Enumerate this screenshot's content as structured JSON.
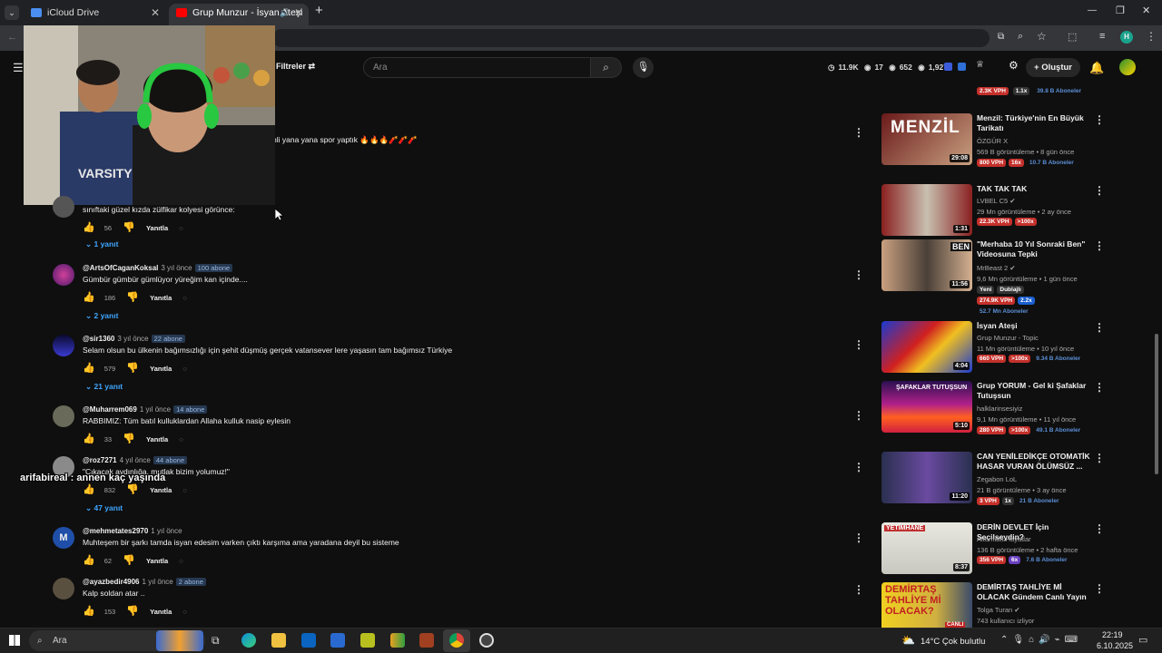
{
  "browser": {
    "tabs": [
      {
        "label": "iCloud Drive",
        "active": false
      },
      {
        "label": "Grup Munzur - İsyan Ateşi",
        "active": true
      }
    ],
    "new_tab": "+",
    "window_min": "—",
    "window_restore": "❐",
    "window_close": "✕"
  },
  "youtube": {
    "filters_label": "Filtreler",
    "search_placeholder": "Ara",
    "stats": {
      "a": "11.9K",
      "b": "17",
      "c": "652",
      "d": "1,927"
    },
    "create_label": "Oluştur"
  },
  "partial_text": {
    "top_comment_tail": "nli yana yana spor yaptık 🔥🔥🔥🧨🧨🧨",
    "top_right_tags": [
      "2.3K VPH",
      "1.1x",
      "39.8 B Aboneler"
    ]
  },
  "comments": [
    {
      "handle": "",
      "date": "",
      "subs": "",
      "text": "sınıftaki güzel kızda zülfikar kolyesi görünce:",
      "likes": "56",
      "reply": "Yanıtla",
      "replies": "1 yanıt"
    },
    {
      "handle": "@ArtsOfCaganKoksal",
      "date": "3 yıl önce",
      "subs": "100 abone",
      "text": "Gümbür gümbür gümlüyor yüreğim kan içinde....",
      "likes": "186",
      "reply": "Yanıtla",
      "replies": "2 yanıt"
    },
    {
      "handle": "@sir1360",
      "date": "3 yıl önce",
      "subs": "22 abone",
      "text": "Selam olsun bu ülkenin bağımsızlığı için şehit düşmüş gerçek  vatansever lere yaşasın tam bağımsız Türkiye",
      "likes": "579",
      "reply": "Yanıtla",
      "replies": "21 yanıt"
    },
    {
      "handle": "@Muharrem069",
      "date": "1 yıl önce",
      "subs": "14 abone",
      "text": "RABBIMIZ: Tüm batıl kulluklardan Allaha kulluk nasip eylesin",
      "likes": "33",
      "reply": "Yanıtla",
      "replies": ""
    },
    {
      "handle": "@roz7271",
      "date": "4 yıl önce",
      "subs": "44 abone",
      "text": "\"Çıkacak aydınlığa, mutlak bizim yolumuz!\"",
      "likes": "832",
      "reply": "Yanıtla",
      "replies": "47 yanıt"
    },
    {
      "handle": "@mehmetates2970",
      "date": "1 yıl önce",
      "subs": "",
      "text": "Muhteşem bir şarkı tamda isyan edesim varken çıktı karşıma ama yaradana deyil bu sisteme",
      "likes": "62",
      "reply": "Yanıtla",
      "replies": "",
      "avatar_letter": "M"
    },
    {
      "handle": "@ayazbedir4906",
      "date": "1 yıl önce",
      "subs": "2 abone",
      "text": "Kalp soldan atar ..",
      "likes": "153",
      "reply": "Yanıtla",
      "replies": ""
    }
  ],
  "overlay_text": "arifabireal : annen kaç yaşında",
  "recommendations": [
    {
      "title": "Menzil: Türkiye'nin En Büyük Tarikatı",
      "channel": "ÖZGÜR X",
      "meta": "569 B görüntüleme • 8 gün önce",
      "duration": "29:08",
      "tags": [
        "800 VPH",
        "16x",
        "10.7 B Aboneler"
      ]
    },
    {
      "title": "TAK TAK TAK",
      "channel": "LVBEL C5 ✔",
      "meta": "29 Mn görüntüleme • 2 ay önce",
      "duration": "1:31",
      "tags": [
        "22.3K VPH",
        ">100x"
      ]
    },
    {
      "title": "\"Merhaba 10 Yıl Sonraki Ben\" Videosuna Tepki",
      "channel": "MrBeast 2 ✔",
      "meta": "9,6 Mn görüntüleme • 1 gün önce",
      "duration": "11:56",
      "tags": [
        "Yeni",
        "Dublajlı",
        "274.9K VPH",
        "2.2x",
        "52.7 Mn Aboneler"
      ]
    },
    {
      "title": "İsyan Ateşi",
      "channel": "Grup Munzur - Topic",
      "meta": "11 Mn görüntüleme • 10 yıl önce",
      "duration": "4:04",
      "tags": [
        "660 VPH",
        ">100x",
        "9.34 B Aboneler"
      ]
    },
    {
      "title": "Grup YORUM - Gel ki Şafaklar Tutuşsun",
      "channel": "halklarinsesiyiz",
      "meta": "9,1 Mn görüntüleme • 11 yıl önce",
      "duration": "5:10",
      "tags": [
        "280 VPH",
        ">100x",
        "49.1 B Aboneler"
      ]
    },
    {
      "title": "CAN YENİLEDİKÇE OTOMATİK HASAR VURAN ÖLÜMSÜZ ...",
      "channel": "Zegabon LoL",
      "meta": "21 B görüntüleme • 3 ay önce",
      "duration": "11:20",
      "tags": [
        "3 VPH",
        "1x",
        "21 B Aboneler"
      ]
    },
    {
      "title": "DERİN DEVLET İçin Seçilseydin?",
      "channel": "Alternatif Hayatlar",
      "meta": "136 B görüntüleme • 2 hafta önce",
      "duration": "8:37",
      "tags": [
        "356 VPH",
        "6x",
        "7.6 B Aboneler"
      ]
    },
    {
      "title": "DEMİRTAŞ TAHLİYE Mİ OLACAK Gündem Canlı Yayın",
      "channel": "Tolga Turan ✔",
      "meta": "743 kullanıcı izliyor",
      "duration": "",
      "tags": []
    }
  ],
  "thumb_labels": {
    "menzil": "MENZİL",
    "safak": "ŞAFAKLAR TUTUŞSUN",
    "yetimhane": "YETİMHANE",
    "demirtas": "DEMİRTAŞ TAHLİYE Mİ OLACAK?",
    "ben": "BEN",
    "canli": "CANLI"
  },
  "taskbar": {
    "search": "Ara",
    "weather": "14°C  Çok bulutlu",
    "time": "22:19",
    "date": "6.10.2025"
  },
  "colors": {
    "accent_blue": "#3ea6ff",
    "vph_red": "#c4302b",
    "bg": "#0f0f0f"
  }
}
